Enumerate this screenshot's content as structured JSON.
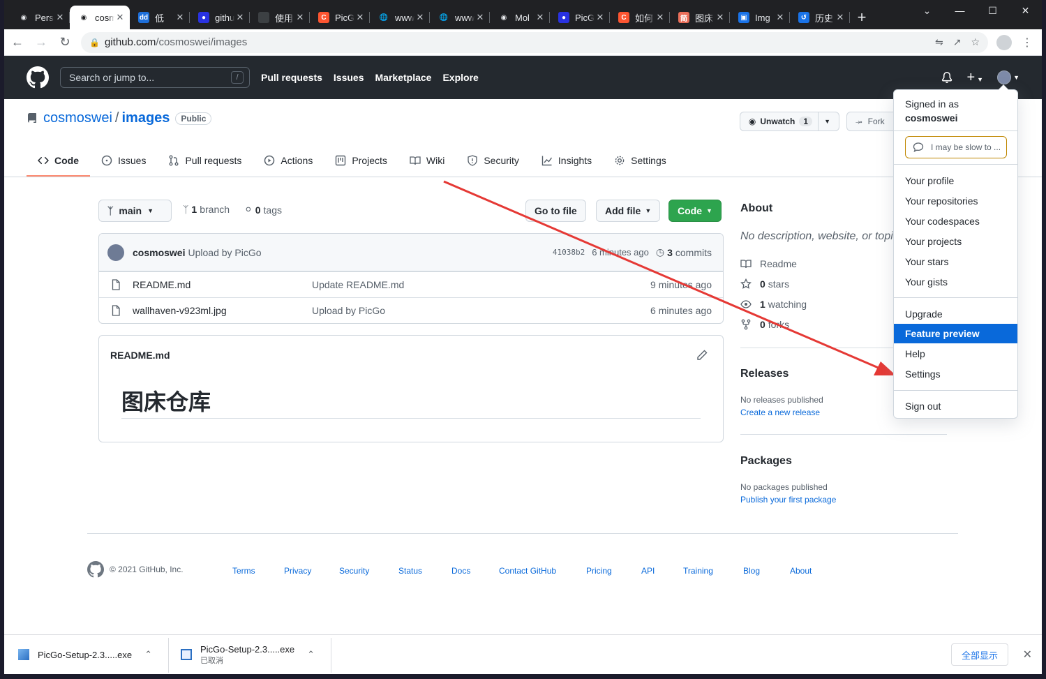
{
  "browser": {
    "tabs": [
      {
        "title": "Personal",
        "icon": "github-icon",
        "color": "#e8eaed"
      },
      {
        "title": "cosmoswei/images",
        "icon": "github-icon",
        "color": "#202124"
      },
      {
        "title": "低",
        "icon": "dd-icon",
        "color": "#1e6fd9"
      },
      {
        "title": "github",
        "icon": "baidu-paw-icon",
        "color": "#2932e1"
      },
      {
        "title": "使用",
        "icon": "blank-icon",
        "color": "#3c4043"
      },
      {
        "title": "PicGo",
        "icon": "csdn-icon",
        "color": "#fc5531"
      },
      {
        "title": "www",
        "icon": "globe-icon",
        "color": "#e8eaed"
      },
      {
        "title": "www",
        "icon": "globe-icon",
        "color": "#e8eaed"
      },
      {
        "title": "Mol",
        "icon": "github-icon",
        "color": "#e8eaed"
      },
      {
        "title": "PicG",
        "icon": "baidu-paw-icon",
        "color": "#2932e1"
      },
      {
        "title": "如何",
        "icon": "csdn-icon",
        "color": "#fc5531"
      },
      {
        "title": "图床",
        "icon": "jianshu-icon",
        "color": "#ea6f5a"
      },
      {
        "title": "Img",
        "icon": "image-icon",
        "color": "#1a73e8"
      },
      {
        "title": "历史",
        "icon": "history-icon",
        "color": "#1a73e8"
      }
    ],
    "new_tab": "+",
    "url_host": "github.com",
    "url_path": "/cosmoswei/images"
  },
  "gh": {
    "search_placeholder": "Search or jump to...",
    "search_key": "/",
    "nav": [
      "Pull requests",
      "Issues",
      "Marketplace",
      "Explore"
    ]
  },
  "repo": {
    "owner": "cosmoswei",
    "sep": "/",
    "name": "images",
    "visibility": "Public",
    "unwatch_label": "Unwatch",
    "watch_count": "1",
    "fork_label": "Fork",
    "tabs": [
      "Code",
      "Issues",
      "Pull requests",
      "Actions",
      "Projects",
      "Wiki",
      "Security",
      "Insights",
      "Settings"
    ]
  },
  "filenav": {
    "branch": "main",
    "branch_count": "1",
    "branch_word": "branch",
    "tag_count": "0",
    "tag_word": "tags",
    "goto_file": "Go to file",
    "add_file": "Add file",
    "code": "Code"
  },
  "commit": {
    "author": "cosmoswei",
    "message": "Upload by PicGo",
    "sha": "41038b2",
    "time": "6 minutes ago",
    "commit_count": "3",
    "commit_word": "commits"
  },
  "files": [
    {
      "name": "README.md",
      "message": "Update README.md",
      "time": "9 minutes ago"
    },
    {
      "name": "wallhaven-v923ml.jpg",
      "message": "Upload by PicGo",
      "time": "6 minutes ago"
    }
  ],
  "readme": {
    "title": "README.md",
    "h1": "图床仓库"
  },
  "about": {
    "heading": "About",
    "description": "No description, website, or topics provided.",
    "readme": "Readme",
    "stars_count": "0",
    "stars_word": "stars",
    "watching_count": "1",
    "watching_word": "watching",
    "forks_count": "0",
    "forks_word": "forks"
  },
  "releases": {
    "heading": "Releases",
    "none": "No releases published",
    "create": "Create a new release"
  },
  "packages": {
    "heading": "Packages",
    "none": "No packages published",
    "publish": "Publish your first package"
  },
  "footer": {
    "copyright": "© 2021 GitHub, Inc.",
    "links": [
      "Terms",
      "Privacy",
      "Security",
      "Status",
      "Docs",
      "Contact GitHub",
      "Pricing",
      "API",
      "Training",
      "Blog",
      "About"
    ]
  },
  "downloads": [
    {
      "name": "PicGo-Setup-2.3.....exe",
      "sub": ""
    },
    {
      "name": "PicGo-Setup-2.3.....exe",
      "sub": "已取消"
    }
  ],
  "show_all": "全部显示",
  "dropdown": {
    "signed_in_as": "Signed in as",
    "username": "cosmoswei",
    "status": "I may be slow to ...",
    "items_a": [
      "Your profile",
      "Your repositories",
      "Your codespaces",
      "Your projects",
      "Your stars",
      "Your gists"
    ],
    "items_b": [
      "Upgrade",
      "Feature preview",
      "Help",
      "Settings"
    ],
    "sign_out": "Sign out",
    "active_item": "Feature preview"
  },
  "colors": {
    "gh_header": "#24292f",
    "link": "#0969da",
    "code_button": "#2da44e",
    "annotation_arrow": "#e53935",
    "dropdown_active": "#0969da"
  }
}
